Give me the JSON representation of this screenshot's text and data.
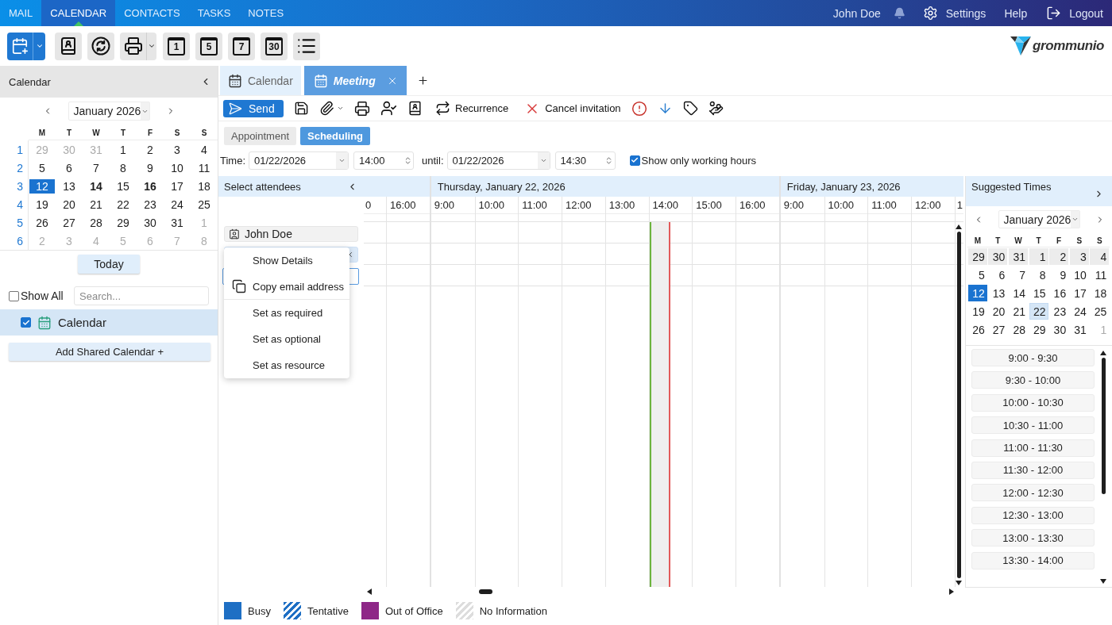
{
  "nav": {
    "tabs": [
      {
        "label": "MAIL",
        "selected": false
      },
      {
        "label": "CALENDAR",
        "selected": true
      },
      {
        "label": "CONTACTS",
        "selected": false
      },
      {
        "label": "TASKS",
        "selected": false
      },
      {
        "label": "NOTES",
        "selected": false
      }
    ],
    "user": "John Doe",
    "settings": "Settings",
    "help": "Help",
    "logout": "Logout"
  },
  "toolbar": {
    "view_buttons": [
      "1",
      "5",
      "7",
      "30"
    ]
  },
  "logo": "grommunio",
  "sidebar": {
    "title": "Calendar",
    "calendar": {
      "month": "January 2026",
      "weekdays": [
        "M",
        "T",
        "W",
        "T",
        "F",
        "S",
        "S"
      ],
      "weeks": [
        {
          "number": "1",
          "days": [
            {
              "label": "29",
              "muted": true,
              "bold": false,
              "today": false,
              "selected": false
            },
            {
              "label": "30",
              "muted": true,
              "bold": false,
              "today": false,
              "selected": false
            },
            {
              "label": "31",
              "muted": true,
              "bold": false,
              "today": false,
              "selected": false
            },
            {
              "label": "1",
              "muted": false,
              "bold": false,
              "today": false,
              "selected": false
            },
            {
              "label": "2",
              "muted": false,
              "bold": false,
              "today": false,
              "selected": false
            },
            {
              "label": "3",
              "muted": false,
              "bold": false,
              "today": false,
              "selected": false
            },
            {
              "label": "4",
              "muted": false,
              "bold": false,
              "today": false,
              "selected": false
            }
          ]
        },
        {
          "number": "2",
          "days": [
            {
              "label": "5",
              "muted": false,
              "bold": false,
              "today": false,
              "selected": false
            },
            {
              "label": "6",
              "muted": false,
              "bold": false,
              "today": false,
              "selected": false
            },
            {
              "label": "7",
              "muted": false,
              "bold": false,
              "today": false,
              "selected": false
            },
            {
              "label": "8",
              "muted": false,
              "bold": false,
              "today": false,
              "selected": false
            },
            {
              "label": "9",
              "muted": false,
              "bold": false,
              "today": false,
              "selected": false
            },
            {
              "label": "10",
              "muted": false,
              "bold": false,
              "today": false,
              "selected": false
            },
            {
              "label": "11",
              "muted": false,
              "bold": false,
              "today": false,
              "selected": false
            }
          ]
        },
        {
          "number": "3",
          "days": [
            {
              "label": "12",
              "muted": false,
              "bold": false,
              "today": true,
              "selected": false
            },
            {
              "label": "13",
              "muted": false,
              "bold": false,
              "today": false,
              "selected": false
            },
            {
              "label": "14",
              "muted": false,
              "bold": true,
              "today": false,
              "selected": false
            },
            {
              "label": "15",
              "muted": false,
              "bold": false,
              "today": false,
              "selected": false
            },
            {
              "label": "16",
              "muted": false,
              "bold": true,
              "today": false,
              "selected": false
            },
            {
              "label": "17",
              "muted": false,
              "bold": false,
              "today": false,
              "selected": false
            },
            {
              "label": "18",
              "muted": false,
              "bold": false,
              "today": false,
              "selected": false
            }
          ]
        },
        {
          "number": "4",
          "days": [
            {
              "label": "19",
              "muted": false,
              "bold": false,
              "today": false,
              "selected": false
            },
            {
              "label": "20",
              "muted": false,
              "bold": false,
              "today": false,
              "selected": false
            },
            {
              "label": "21",
              "muted": false,
              "bold": false,
              "today": false,
              "selected": false
            },
            {
              "label": "22",
              "muted": false,
              "bold": false,
              "today": false,
              "selected": false
            },
            {
              "label": "23",
              "muted": false,
              "bold": false,
              "today": false,
              "selected": false
            },
            {
              "label": "24",
              "muted": false,
              "bold": false,
              "today": false,
              "selected": false
            },
            {
              "label": "25",
              "muted": false,
              "bold": false,
              "today": false,
              "selected": false
            }
          ]
        },
        {
          "number": "5",
          "days": [
            {
              "label": "26",
              "muted": false,
              "bold": false,
              "today": false,
              "selected": false
            },
            {
              "label": "27",
              "muted": false,
              "bold": false,
              "today": false,
              "selected": false
            },
            {
              "label": "28",
              "muted": false,
              "bold": false,
              "today": false,
              "selected": false
            },
            {
              "label": "29",
              "muted": false,
              "bold": false,
              "today": false,
              "selected": false
            },
            {
              "label": "30",
              "muted": false,
              "bold": false,
              "today": false,
              "selected": false
            },
            {
              "label": "31",
              "muted": false,
              "bold": false,
              "today": false,
              "selected": false
            },
            {
              "label": "1",
              "muted": true,
              "bold": false,
              "today": false,
              "selected": false
            }
          ]
        },
        {
          "number": "6",
          "days": [
            {
              "label": "2",
              "muted": true,
              "bold": false,
              "today": false,
              "selected": false
            },
            {
              "label": "3",
              "muted": true,
              "bold": false,
              "today": false,
              "selected": false
            },
            {
              "label": "4",
              "muted": true,
              "bold": false,
              "today": false,
              "selected": false
            },
            {
              "label": "5",
              "muted": true,
              "bold": false,
              "today": false,
              "selected": false
            },
            {
              "label": "6",
              "muted": true,
              "bold": false,
              "today": false,
              "selected": false
            },
            {
              "label": "7",
              "muted": true,
              "bold": false,
              "today": false,
              "selected": false
            },
            {
              "label": "8",
              "muted": true,
              "bold": false,
              "today": false,
              "selected": false
            }
          ]
        }
      ]
    },
    "today_button": "Today",
    "show_all": {
      "label": "Show All",
      "checked": false
    },
    "search": {
      "placeholder": "Search..."
    },
    "calendars": [
      {
        "label": "Calendar",
        "checked": true,
        "selected": true
      }
    ],
    "add_shared": "Add Shared Calendar +"
  },
  "tabs": [
    {
      "label": "Calendar",
      "selected": false,
      "closable": false
    },
    {
      "label": "Meeting",
      "selected": true,
      "closable": true
    }
  ],
  "actions": {
    "send": "Send",
    "recurrence": "Recurrence",
    "cancel": "Cancel invitation"
  },
  "subtabs": [
    {
      "label": "Appointment",
      "selected": false
    },
    {
      "label": "Scheduling",
      "selected": true
    }
  ],
  "time": {
    "label": "Time:",
    "start_date": "01/22/2026",
    "start_time": "14:00",
    "until_label": "until:",
    "end_date": "01/22/2026",
    "end_time": "14:30",
    "working_hours": {
      "label": "Show only working hours",
      "checked": true
    }
  },
  "attendees": {
    "title": "Select attendees",
    "items": [
      {
        "name": "John Doe",
        "selected": false
      },
      {
        "selected": true
      }
    ]
  },
  "context_menu": [
    {
      "label": "Show Details",
      "kind": "plain",
      "separator_after": false
    },
    {
      "label": "Copy email address",
      "kind": "copy",
      "separator_after": true
    },
    {
      "label": "Set as required",
      "kind": "plain",
      "separator_after": false
    },
    {
      "label": "Set as optional",
      "kind": "plain",
      "separator_after": false
    },
    {
      "label": "Set as resource",
      "kind": "plain",
      "separator_after": false
    }
  ],
  "schedule": {
    "days": [
      {
        "hours": [
          {
            "label": "0",
            "partial": true,
            "meeting": false
          },
          {
            "label": "16:00",
            "partial": false,
            "meeting": false
          }
        ]
      },
      {
        "header": "Thursday, January 22, 2026",
        "hours": [
          {
            "label": "9:00",
            "partial": false,
            "meeting": false
          },
          {
            "label": "10:00",
            "partial": false,
            "meeting": false
          },
          {
            "label": "11:00",
            "partial": false,
            "meeting": false
          },
          {
            "label": "12:00",
            "partial": false,
            "meeting": false
          },
          {
            "label": "13:00",
            "partial": false,
            "meeting": false
          },
          {
            "label": "14:00",
            "partial": false,
            "meeting": true
          },
          {
            "label": "15:00",
            "partial": false,
            "meeting": false
          },
          {
            "label": "16:00",
            "partial": false,
            "meeting": false
          }
        ]
      },
      {
        "header": "Friday, January 23, 2026",
        "hours": [
          {
            "label": "9:00",
            "partial": false,
            "meeting": false
          },
          {
            "label": "10:00",
            "partial": false,
            "meeting": false
          },
          {
            "label": "11:00",
            "partial": false,
            "meeting": false
          },
          {
            "label": "12:00",
            "partial": false,
            "meeting": false
          },
          {
            "label": "1",
            "partial": true,
            "meeting": false
          }
        ]
      }
    ]
  },
  "suggested": {
    "title": "Suggested Times",
    "calendar": {
      "month": "January 2026",
      "weekdays": [
        "M",
        "T",
        "W",
        "T",
        "F",
        "S",
        "S"
      ],
      "weeks": [
        {
          "shaded": true,
          "days": [
            {
              "label": "29",
              "muted": false,
              "today": false,
              "selected": false
            },
            {
              "label": "30",
              "muted": false,
              "today": false,
              "selected": false
            },
            {
              "label": "31",
              "muted": false,
              "today": false,
              "selected": false
            },
            {
              "label": "1",
              "muted": false,
              "today": false,
              "selected": false
            },
            {
              "label": "2",
              "muted": false,
              "today": false,
              "selected": false
            },
            {
              "label": "3",
              "muted": false,
              "today": false,
              "selected": false
            },
            {
              "label": "4",
              "muted": false,
              "today": false,
              "selected": false
            }
          ]
        },
        {
          "shaded": false,
          "days": [
            {
              "label": "5",
              "muted": false,
              "today": false,
              "selected": false
            },
            {
              "label": "6",
              "muted": false,
              "today": false,
              "selected": false
            },
            {
              "label": "7",
              "muted": false,
              "today": false,
              "selected": false
            },
            {
              "label": "8",
              "muted": false,
              "today": false,
              "selected": false
            },
            {
              "label": "9",
              "muted": false,
              "today": false,
              "selected": false
            },
            {
              "label": "10",
              "muted": false,
              "today": false,
              "selected": false
            },
            {
              "label": "11",
              "muted": false,
              "today": false,
              "selected": false
            }
          ]
        },
        {
          "shaded": false,
          "days": [
            {
              "label": "12",
              "muted": false,
              "today": true,
              "selected": false
            },
            {
              "label": "13",
              "muted": false,
              "today": false,
              "selected": false
            },
            {
              "label": "14",
              "muted": false,
              "today": false,
              "selected": false
            },
            {
              "label": "15",
              "muted": false,
              "today": false,
              "selected": false
            },
            {
              "label": "16",
              "muted": false,
              "today": false,
              "selected": false
            },
            {
              "label": "17",
              "muted": false,
              "today": false,
              "selected": false
            },
            {
              "label": "18",
              "muted": false,
              "today": false,
              "selected": false
            }
          ]
        },
        {
          "shaded": false,
          "days": [
            {
              "label": "19",
              "muted": false,
              "today": false,
              "selected": false
            },
            {
              "label": "20",
              "muted": false,
              "today": false,
              "selected": false
            },
            {
              "label": "21",
              "muted": false,
              "today": false,
              "selected": false
            },
            {
              "label": "22",
              "muted": false,
              "today": false,
              "selected": true
            },
            {
              "label": "23",
              "muted": false,
              "today": false,
              "selected": false
            },
            {
              "label": "24",
              "muted": false,
              "today": false,
              "selected": false
            },
            {
              "label": "25",
              "muted": false,
              "today": false,
              "selected": false
            }
          ]
        },
        {
          "shaded": false,
          "days": [
            {
              "label": "26",
              "muted": false,
              "today": false,
              "selected": false
            },
            {
              "label": "27",
              "muted": false,
              "today": false,
              "selected": false
            },
            {
              "label": "28",
              "muted": false,
              "today": false,
              "selected": false
            },
            {
              "label": "29",
              "muted": false,
              "today": false,
              "selected": false
            },
            {
              "label": "30",
              "muted": false,
              "today": false,
              "selected": false
            },
            {
              "label": "31",
              "muted": false,
              "today": false,
              "selected": false
            },
            {
              "label": "1",
              "muted": true,
              "today": false,
              "selected": false
            }
          ]
        }
      ]
    },
    "slots": [
      "9:00 - 9:30",
      "9:30 - 10:00",
      "10:00 - 10:30",
      "10:30 - 11:00",
      "11:00 - 11:30",
      "11:30 - 12:00",
      "12:00 - 12:30",
      "12:30 - 13:00",
      "13:00 - 13:30",
      "13:30 - 14:00"
    ]
  },
  "legend": [
    {
      "label": "Busy",
      "kind": "solid",
      "color": "#1e6fc4"
    },
    {
      "label": "Tentative",
      "kind": "striped",
      "color": "#1e6fc4"
    },
    {
      "label": "Out of Office",
      "kind": "solid",
      "color": "#8e2787"
    },
    {
      "label": "No Information",
      "kind": "striped",
      "color": "#dddddd"
    }
  ]
}
